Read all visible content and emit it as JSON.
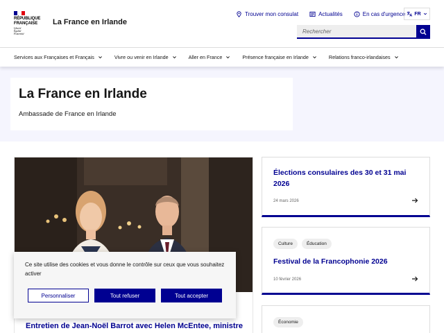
{
  "header": {
    "logo": {
      "line1": "RÉPUBLIQUE",
      "line2": "FRANÇAISE",
      "motto1": "Liberté",
      "motto2": "Égalité",
      "motto3": "Fraternité"
    },
    "site_title": "La France en Irlande",
    "tools": {
      "consulate": "Trouver mon consulat",
      "news": "Actualités",
      "emergency": "En cas d'urgence",
      "lang": "FR"
    },
    "search": {
      "placeholder": "Rechercher"
    }
  },
  "nav": {
    "items": [
      "Services aux Françaises et Français",
      "Vivre ou venir en Irlande",
      "Aller en France",
      "Présence française en Irlande",
      "Relations franco-irlandaises"
    ]
  },
  "hero": {
    "title": "La France en Irlande",
    "subtitle": "Ambassade de France en Irlande"
  },
  "feature": {
    "title": "Entretien de Jean-Noël Barrot avec Helen McEntee, ministre des Affaires étrangères"
  },
  "cards": [
    {
      "title": "Élections consulaires des 30 et 31 mai 2026",
      "date": "24 mars 2026",
      "tags": []
    },
    {
      "title": "Festival de la Francophonie 2026",
      "date": "10 février 2026",
      "tags": [
        "Culture",
        "Éducation"
      ]
    },
    {
      "title": "",
      "date": "",
      "tags": [
        "Économie"
      ]
    }
  ],
  "cookie": {
    "text": "Ce site utilise des cookies et vous donne le contrôle sur ceux que vous souhaitez activer",
    "customize": "Personnaliser",
    "reject": "Tout refuser",
    "accept": "Tout accepter"
  },
  "colors": {
    "primary": "#000091",
    "hero_bg": "#f5f5fe",
    "flag_blue": "#000091",
    "flag_red": "#e1000f"
  }
}
